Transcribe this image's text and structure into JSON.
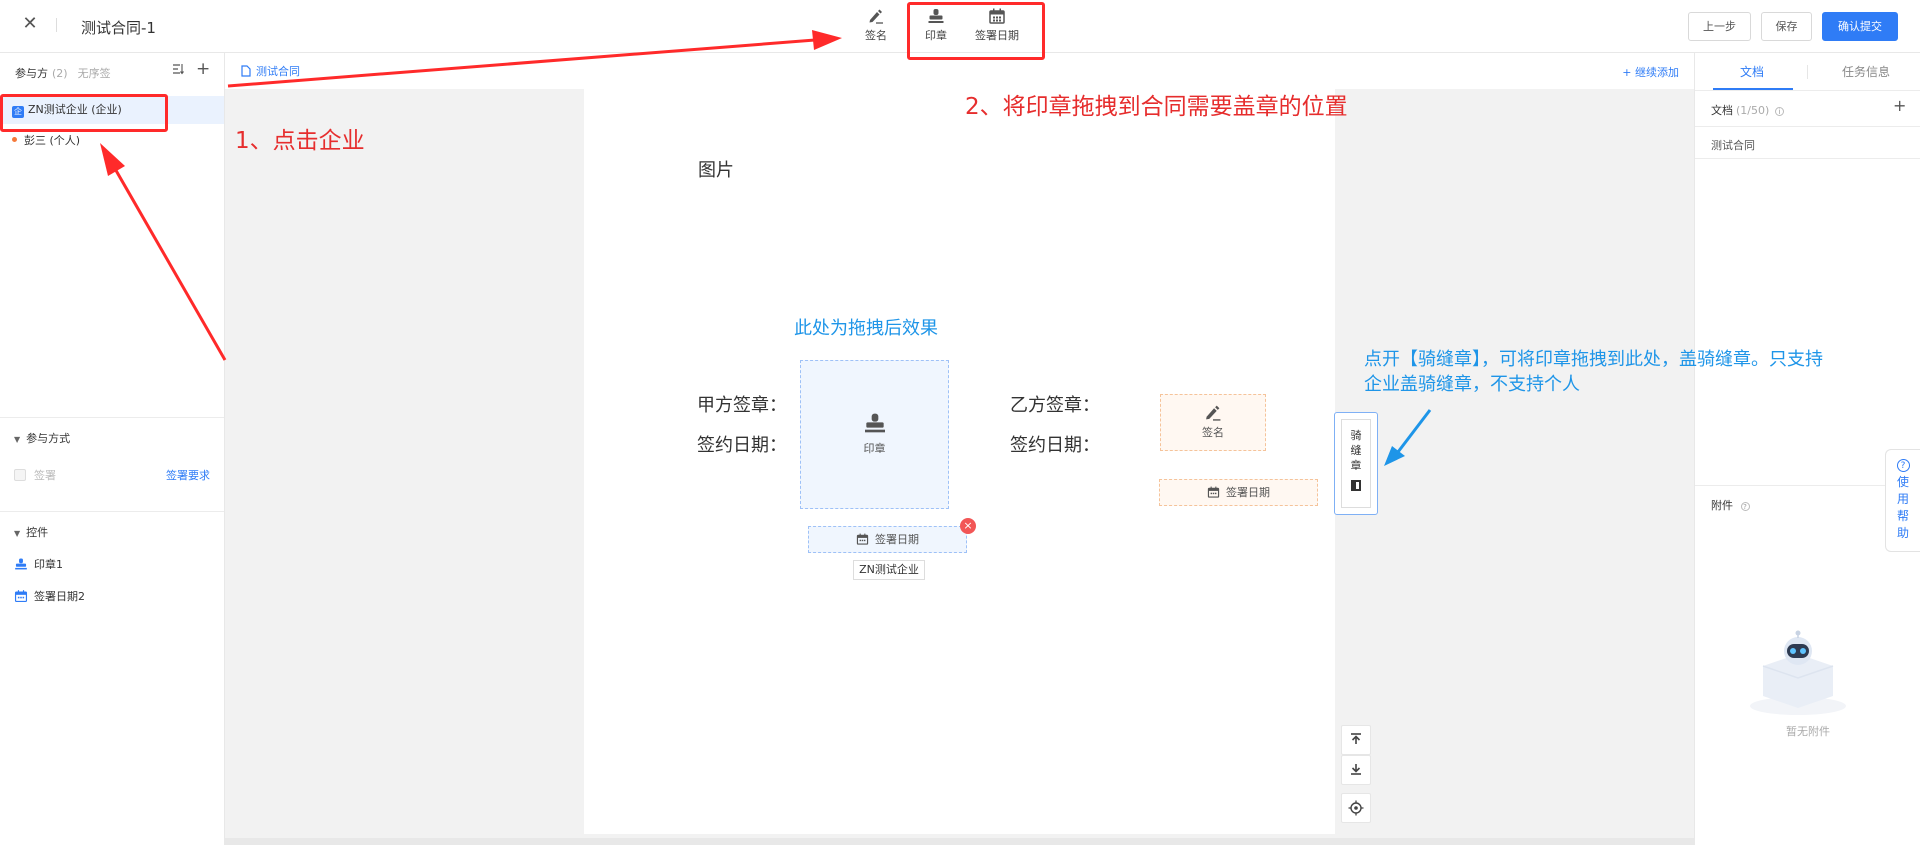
{
  "topbar": {
    "title": "测试合同-1",
    "tools": {
      "sign": "签名",
      "seal": "印章",
      "sign_date": "签署日期"
    },
    "buttons": {
      "prev": "上一步",
      "save": "保存",
      "confirm": "确认提交"
    }
  },
  "left": {
    "participants_label": "参与方",
    "participants_count": "(2)",
    "order_label": "无序签",
    "parties": [
      {
        "badge": "企",
        "label": "ZN测试企业 (企业)"
      },
      {
        "label": "彭三 (个人)"
      }
    ],
    "mode_section": {
      "title": "参与方式",
      "item": "签署",
      "requirement": "签署要求"
    },
    "controls_section": {
      "title": "控件",
      "items": [
        "印章1",
        "签署日期2"
      ]
    }
  },
  "center": {
    "doc_tab": "测试合同",
    "add_more": "+ 继续添加",
    "paper": {
      "picture_label": "图片",
      "party_a_seal": "甲方签章：",
      "party_a_date": "签约日期：",
      "party_b_seal": "乙方签章：",
      "party_b_date": "签约日期：",
      "seal_field": "印章",
      "date_field_a": "签署日期",
      "company_name": "ZN测试企业",
      "sign_field": "签名",
      "date_field_b": "签署日期"
    },
    "riding_seal": [
      "骑",
      "缝",
      "章"
    ]
  },
  "right": {
    "tabs": [
      "文档",
      "任务信息"
    ],
    "docs_label": "文档",
    "docs_count": "(1/50)",
    "doc_item": "测试合同",
    "attach_label": "附件",
    "empty_text": "暂无附件",
    "help": [
      "使",
      "用",
      "帮",
      "助"
    ]
  },
  "annotations": {
    "step1": "1、点击企业",
    "step2": "2、将印章拖拽到合同需要盖章的位置",
    "drag_effect": "此处为拖拽后效果",
    "riding_tip_line1": "点开【骑缝章】，可将印章拖拽到此处，盖骑缝章。只支持",
    "riding_tip_line2": "企业盖骑缝章，不支持个人"
  },
  "colors": {
    "accent": "#2f7cf6",
    "annotation_red": "#ff2a2a",
    "annotation_blue": "#1e95e8",
    "sign_field": "#f5a15c"
  }
}
